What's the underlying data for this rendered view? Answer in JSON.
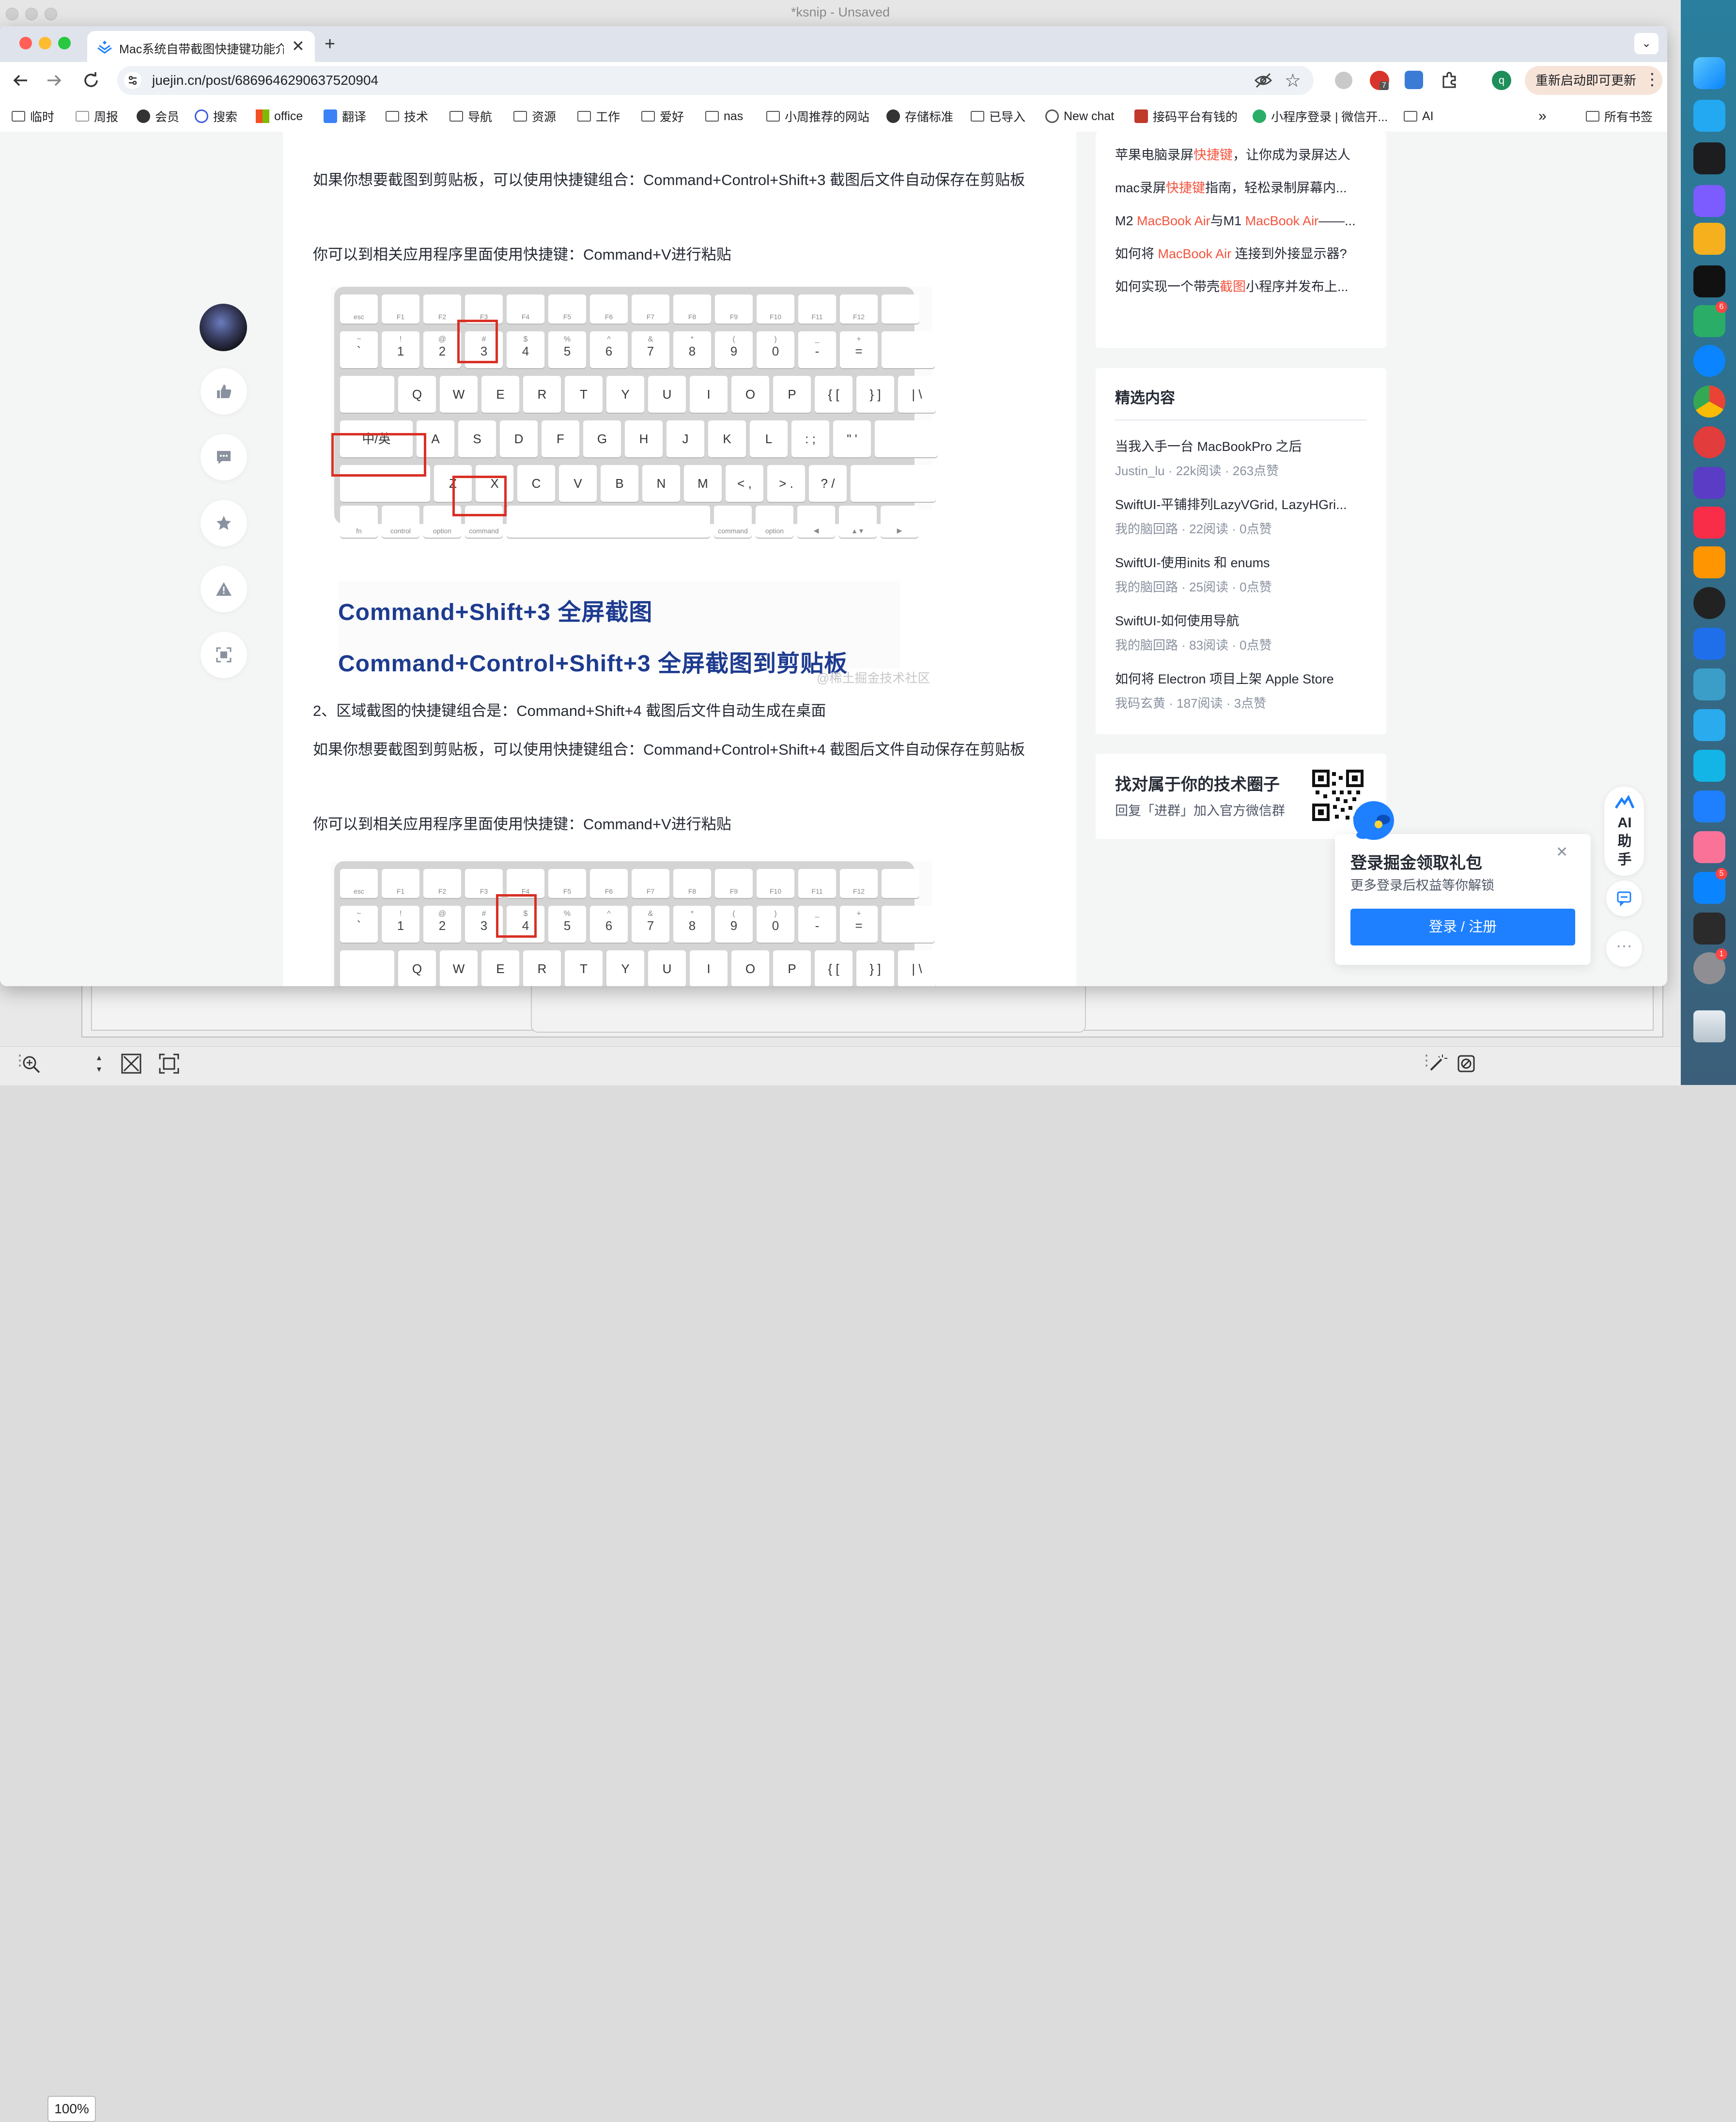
{
  "ksnip": {
    "title": "*ksnip - Unsaved",
    "zoom": "100%"
  },
  "browser": {
    "tab_title": "Mac系统自带截图快捷键功能介",
    "url": "juejin.cn/post/6869646290637520904",
    "ext_badge": "7",
    "profile_initial": "q",
    "update_button": "重新启动即可更新",
    "bookmarks": [
      "临时",
      "周报",
      "会员",
      "搜索",
      "office",
      "翻译",
      "技术",
      "导航",
      "资源",
      "工作",
      "爱好",
      "nas",
      "小周推荐的网站",
      "存储标准",
      "已导入",
      "New chat",
      "接码平台有钱的",
      "小程序登录 | 微信开...",
      "AI"
    ],
    "all_bookmarks": "所有书签",
    "more_bookmarks": "»"
  },
  "article": {
    "p1": "如果你想要截图到剪贴板，可以使用快捷键组合：Command+Control+Shift+3 截图后文件自动保存在剪贴板",
    "p2": "你可以到相关应用程序里面使用快捷键：Command+V进行粘贴",
    "img1_caption1": "Command+Shift+3 全屏截图",
    "img1_caption2": "Command+Control+Shift+3 全屏截图到剪贴板",
    "watermark": "@稀土掘金技术社区",
    "p3": "2、区域截图的快捷键组合是：Command+Shift+4 截图后文件自动生成在桌面",
    "p4": "如果你想要截图到剪贴板，可以使用快捷键组合：Command+Control+Shift+4 截图后文件自动保存在剪贴板",
    "p5": "你可以到相关应用程序里面使用快捷键：Command+V进行粘贴"
  },
  "keyboard": {
    "fn_row": [
      "esc",
      "F1",
      "F2",
      "F3",
      "F4",
      "F5",
      "F6",
      "F7",
      "F8",
      "F9",
      "F10",
      "F11",
      "F12",
      ""
    ],
    "num_row": [
      [
        "~",
        "`"
      ],
      [
        "!",
        "1"
      ],
      [
        "@",
        "2"
      ],
      [
        "#",
        "3"
      ],
      [
        "$",
        "4"
      ],
      [
        "%",
        "5"
      ],
      [
        "^",
        "6"
      ],
      [
        "&",
        "7"
      ],
      [
        "*",
        "8"
      ],
      [
        "(",
        "9"
      ],
      [
        ")",
        "0"
      ],
      [
        "_",
        "-"
      ],
      [
        "+",
        "="
      ],
      [
        "",
        ""
      ]
    ],
    "q_row": [
      "",
      "Q",
      "W",
      "E",
      "R",
      "T",
      "Y",
      "U",
      "I",
      "O",
      "P",
      "{ [",
      "} ]",
      "| \\"
    ],
    "a_row": [
      "中/英",
      "A",
      "S",
      "D",
      "F",
      "G",
      "H",
      "J",
      "K",
      "L",
      ": ;",
      "\" '",
      ""
    ],
    "z_row": [
      "",
      "Z",
      "X",
      "C",
      "V",
      "B",
      "N",
      "M",
      "< ,",
      "> .",
      "? /",
      ""
    ],
    "b_row": [
      "fn",
      "control",
      "option",
      "command",
      "",
      "command",
      "option",
      "◀",
      "▲▼",
      "▶"
    ]
  },
  "right": {
    "related": [
      {
        "pre": "苹果电脑录屏",
        "hl": "快捷键",
        "post": "，让你成为录屏达人"
      },
      {
        "pre": "mac录屏",
        "hl": "快捷键",
        "post": "指南，轻松录制屏幕内..."
      },
      {
        "pre": "M2 ",
        "hl": "MacBook Air",
        "mid": "与M1 ",
        "hl2": "MacBook Air",
        "post": "——..."
      },
      {
        "pre": "如何将 ",
        "hl": "MacBook Air",
        "post": " 连接到外接显示器?"
      },
      {
        "pre": "如何实现一个带壳",
        "hl": "截图",
        "post": "小程序并发布上..."
      }
    ],
    "picks_title": "精选内容",
    "picks": [
      {
        "title": "当我入手一台 MacBookPro 之后",
        "meta": "Justin_lu · 22k阅读 · 263点赞"
      },
      {
        "title": "SwiftUI-平铺排列LazyVGrid, LazyHGri...",
        "meta": "我的脑回路 · 22阅读 · 0点赞"
      },
      {
        "title": "SwiftUI-使用inits 和 enums",
        "meta": "我的脑回路 · 25阅读 · 0点赞"
      },
      {
        "title": "SwiftUI-如何使用导航",
        "meta": "我的脑回路 · 83阅读 · 0点赞"
      },
      {
        "title": "如何将 Electron 项目上架 Apple Store",
        "meta": "我码玄黄 · 187阅读 · 3点赞"
      }
    ],
    "circle_title": "找对属于你的技术圈子",
    "circle_sub": "回复「进群」加入官方微信群"
  },
  "ai": {
    "label": "AI助手"
  },
  "login_popup": {
    "title": "登录掘金领取礼包",
    "sub": "更多登录后权益等你解锁",
    "button": "登录 / 注册"
  },
  "dock": {
    "badges": {
      "wechat": "6",
      "appstore": "5",
      "settings": "1"
    }
  },
  "colors": {
    "accent": "#1e80ff",
    "highlight": "#f5533d",
    "key_box": "#d93025",
    "caption": "#1d3b8f"
  }
}
